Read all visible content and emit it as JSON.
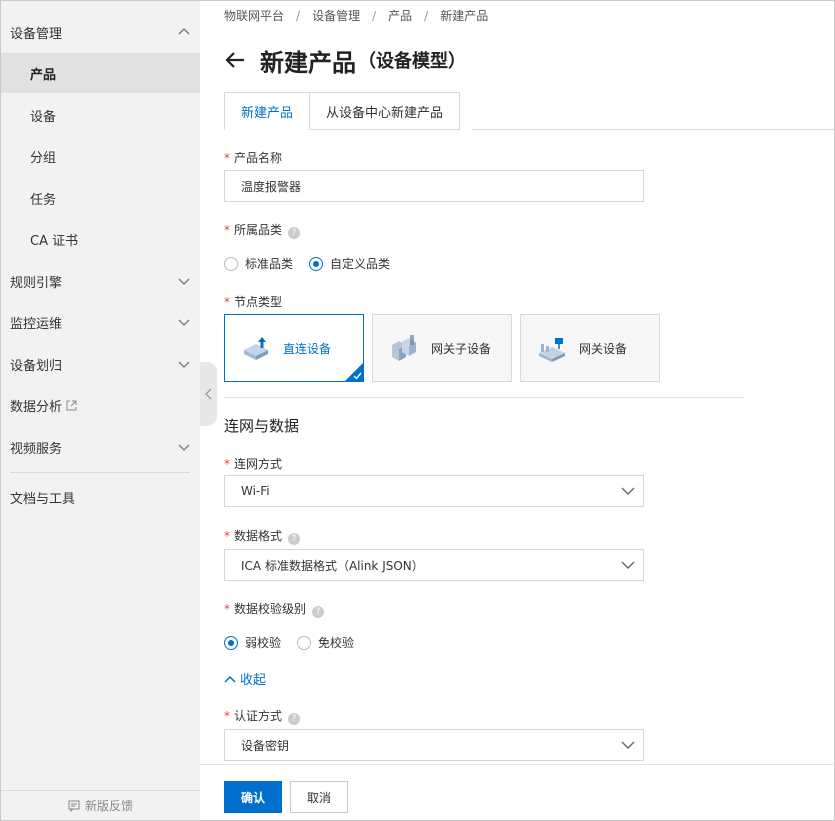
{
  "sidebar": {
    "items": [
      {
        "label": "设备管理",
        "level": "top",
        "expanded": true
      },
      {
        "label": "产品",
        "level": "sub",
        "active": true
      },
      {
        "label": "设备",
        "level": "sub"
      },
      {
        "label": "分组",
        "level": "sub"
      },
      {
        "label": "任务",
        "level": "sub"
      },
      {
        "label": "CA 证书",
        "level": "sub"
      },
      {
        "label": "规则引擎",
        "level": "top"
      },
      {
        "label": "监控运维",
        "level": "top"
      },
      {
        "label": "设备划归",
        "level": "top"
      },
      {
        "label": "数据分析",
        "level": "top",
        "external": true
      },
      {
        "label": "视频服务",
        "level": "top"
      },
      {
        "label": "文档与工具",
        "level": "top"
      }
    ],
    "feedback_label": "新版反馈"
  },
  "breadcrumb": [
    "物联网平台",
    "设备管理",
    "产品",
    "新建产品"
  ],
  "page": {
    "title": "新建产品",
    "subtitle": "（设备模型）"
  },
  "tabs": [
    {
      "label": "新建产品",
      "active": true
    },
    {
      "label": "从设备中心新建产品",
      "active": false
    }
  ],
  "form": {
    "product_name": {
      "label": "产品名称",
      "value": "温度报警器"
    },
    "category": {
      "label": "所属品类",
      "options": [
        {
          "label": "标准品类",
          "checked": false
        },
        {
          "label": "自定义品类",
          "checked": true
        }
      ]
    },
    "node_type": {
      "label": "节点类型",
      "options": [
        {
          "label": "直连设备",
          "selected": true,
          "icon": "direct-device-icon"
        },
        {
          "label": "网关子设备",
          "selected": false,
          "icon": "gateway-sub-device-icon"
        },
        {
          "label": "网关设备",
          "selected": false,
          "icon": "gateway-device-icon"
        }
      ]
    },
    "section_title": "连网与数据",
    "network": {
      "label": "连网方式",
      "value": "Wi-Fi"
    },
    "data_format": {
      "label": "数据格式",
      "value": "ICA 标准数据格式（Alink JSON）"
    },
    "check_level": {
      "label": "数据校验级别",
      "options": [
        {
          "label": "弱校验",
          "checked": true
        },
        {
          "label": "免校验",
          "checked": false
        }
      ]
    },
    "collapse_label": "收起",
    "auth": {
      "label": "认证方式",
      "value": "设备密钥"
    }
  },
  "buttons": {
    "confirm": "确认",
    "cancel": "取消"
  },
  "colors": {
    "accent": "#0070cc",
    "required": "#e54545",
    "sidebar_bg": "#f2f2f2"
  }
}
